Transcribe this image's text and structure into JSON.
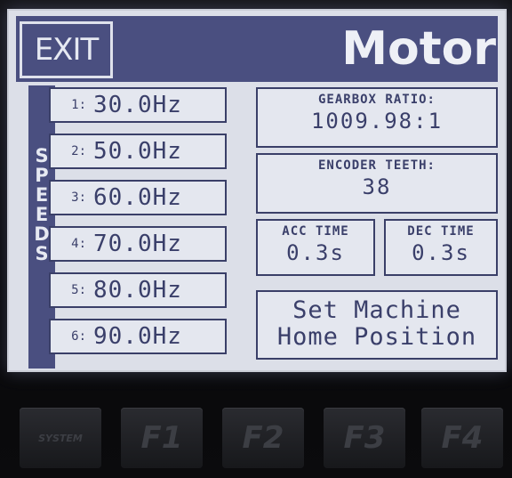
{
  "header": {
    "exit_label": "EXIT",
    "title": "Motor"
  },
  "speeds": {
    "label_letters": [
      "S",
      "P",
      "E",
      "E",
      "D",
      "S"
    ],
    "items": [
      {
        "index": "1:",
        "value": "30.0Hz"
      },
      {
        "index": "2:",
        "value": "50.0Hz"
      },
      {
        "index": "3:",
        "value": "60.0Hz"
      },
      {
        "index": "4:",
        "value": "70.0Hz"
      },
      {
        "index": "5:",
        "value": "80.0Hz"
      },
      {
        "index": "6:",
        "value": "90.0Hz"
      }
    ]
  },
  "gearbox": {
    "label": "GEARBOX RATIO:",
    "value": "1009.98:1"
  },
  "encoder": {
    "label": "ENCODER TEETH:",
    "value": "38"
  },
  "acc": {
    "label": "ACC TIME",
    "value": "0.3s"
  },
  "dec": {
    "label": "DEC TIME",
    "value": "0.3s"
  },
  "home": {
    "line1": "Set Machine",
    "line2": "Home Position"
  },
  "keys": {
    "system": "SYSTEM",
    "f1": "F1",
    "f2": "F2",
    "f3": "F3",
    "f4": "F4"
  },
  "colors": {
    "screen_bg": "#dcdfe8",
    "accent": "#4a4f80",
    "text": "#3a3f6a"
  }
}
